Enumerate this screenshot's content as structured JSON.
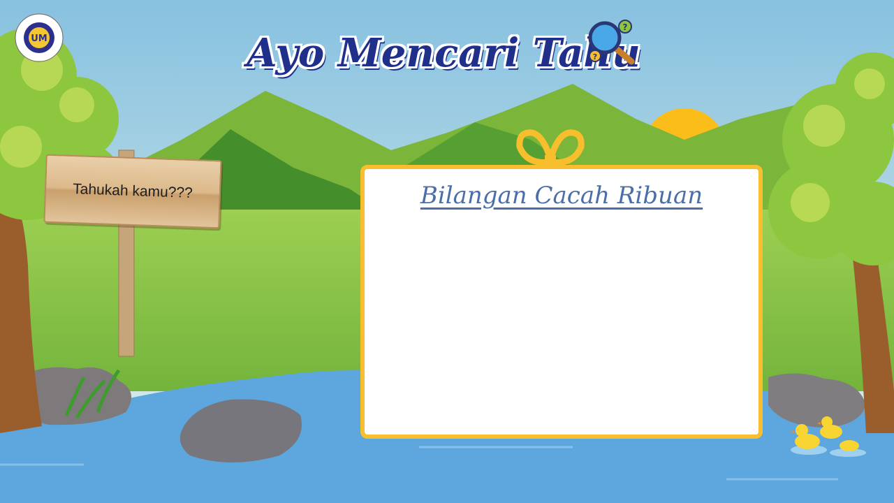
{
  "header": {
    "title": "Ayo Mencari Tahu",
    "logo_text": "UNIVERSITAS NEGERI MALANG"
  },
  "sign": {
    "text": "Tahukah kamu???"
  },
  "card": {
    "title": "Bilangan Cacah Ribuan"
  },
  "icons": {
    "logo": "university-logo-icon",
    "magnifier": "magnifier-question-icon",
    "bow": "ribbon-bow-icon",
    "sun": "sun-icon",
    "ducks": "duck-icon"
  },
  "colors": {
    "sky": "#a6d3e6",
    "water": "#5ea7de",
    "grass": "#7dbd3a",
    "card_border": "#f7bf2e",
    "title": "#1f2f8a",
    "card_title": "#4a6ea8"
  }
}
